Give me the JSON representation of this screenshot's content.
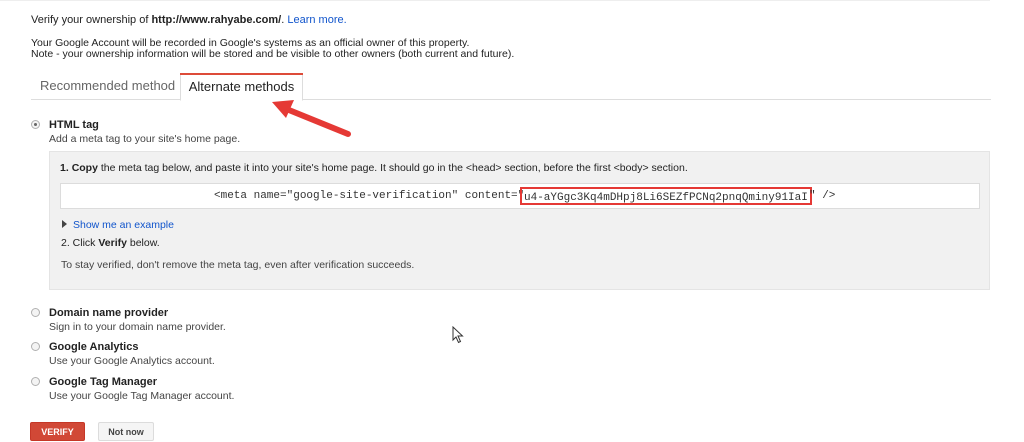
{
  "intro": {
    "prefix": "Verify your ownership of ",
    "site": "http://www.rahyabe.com/",
    "suffix": ". ",
    "learn_more": "Learn more."
  },
  "note": {
    "line1": "Your Google Account will be recorded in Google's systems as an official owner of this property.",
    "line2": "Note - your ownership information will be stored and be visible to other owners (both current and future)."
  },
  "tabs": [
    {
      "label": "Recommended method",
      "active": false
    },
    {
      "label": "Alternate methods",
      "active": true
    }
  ],
  "options": {
    "html_tag": {
      "title": "HTML tag",
      "desc": "Add a meta tag to your site's home page.",
      "selected": true
    },
    "domain": {
      "title": "Domain name provider",
      "desc": "Sign in to your domain name provider.",
      "selected": false
    },
    "analytics": {
      "title": "Google Analytics",
      "desc": "Use your Google Analytics account.",
      "selected": false
    },
    "tag_manager": {
      "title": "Google Tag Manager",
      "desc": "Use your Google Tag Manager account.",
      "selected": false
    }
  },
  "panel": {
    "step1_num": "1. ",
    "step1_bold": "Copy",
    "step1_rest": " the meta tag below, and paste it into your site's home page. It should go in the <head> section, before the first <body> section.",
    "meta_prefix": "<meta name=\"google-site-verification\" content=\"",
    "meta_token": "u4-aYGgc3Kq4mDHpj8Li6SEZfPCNq2pnqQminy91IaI",
    "meta_suffix": "\" />",
    "show_example": "Show me an example",
    "step2_pre": "2. Click ",
    "step2_bold": "Verify",
    "step2_post": " below.",
    "stay": "To stay verified, don't remove the meta tag, even after verification succeeds."
  },
  "buttons": {
    "verify": "VERIFY",
    "not_now": "Not now"
  },
  "colors": {
    "accent_red": "#dd4b39",
    "link_blue": "#1155cc",
    "annotation_red": "#e53935",
    "verify_button": "#d14836"
  },
  "icons": {
    "arrow": "annotation-arrow-icon",
    "cursor": "mouse-pointer-icon",
    "disclosure": "triangle-right-icon"
  }
}
